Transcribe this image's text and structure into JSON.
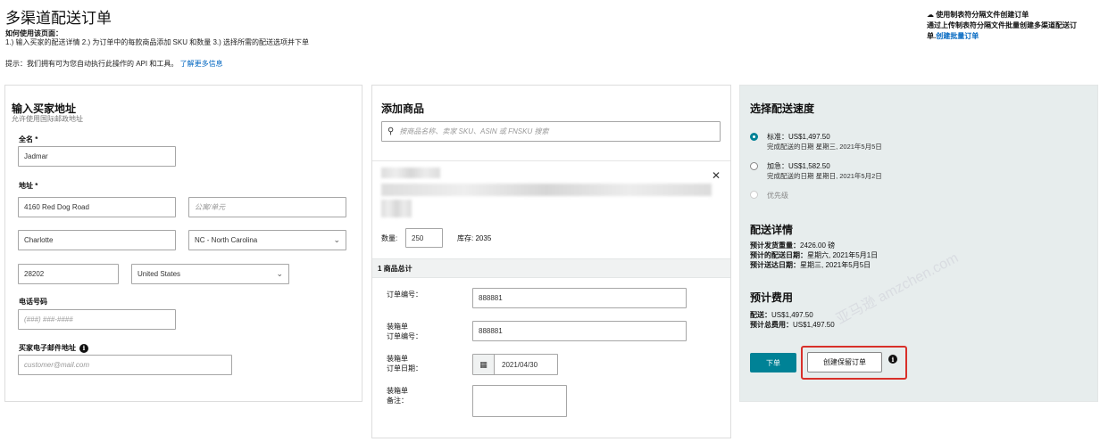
{
  "page": {
    "title": "多渠道配送订单",
    "help_heading": "如何使用该页面：",
    "help_text": "1.) 输入买家的配送详情 2.) 为订单中的每款商品添加 SKU 和数量 3.) 选择所需的配送选项并下单",
    "tip_text": "提示：我们拥有可为您自动执行此操作的 API 和工具。",
    "tip_link": "了解更多信息"
  },
  "bulk": {
    "icon": "cloud-upload-icon",
    "title": "使用制表符分隔文件创建订单",
    "desc": "通过上传制表符分隔文件批量创建多渠道配送订",
    "desc2": "单.",
    "link": "创建批量订单"
  },
  "address": {
    "heading": "输入买家地址",
    "subheading": "允许使用国际邮政地址",
    "name_label": "全名 *",
    "name_value": "Jadmar",
    "address_label": "地址 *",
    "address1_value": "4160  Red Dog Road",
    "address2_placeholder": "公寓/单元",
    "city_value": "Charlotte",
    "state_value": "NC - North Carolina",
    "zip_value": "28202",
    "country_value": "United States",
    "phone_label": "电话号码",
    "phone_placeholder": "(###) ###-####",
    "email_label": "买家电子邮件地址",
    "email_placeholder": "customer@mail.com"
  },
  "products": {
    "heading": "添加商品",
    "search_placeholder": "按商品名称、卖家 SKU、ASIN 或 FNSKU 搜索",
    "qty_label": "数量:",
    "qty_value": "250",
    "stock_label": "库存:",
    "stock_value": "2035",
    "total_label": "1 商品总计",
    "order_id_label": "订单编号：",
    "order_id_value": "888881",
    "packing_id_label": "装箱单\n订单编号：",
    "packing_id_value": "888881",
    "packing_date_label": "装箱单\n订单日期：",
    "packing_date_value": "2021/04/30",
    "packing_note_label": "装箱单\n备注："
  },
  "shipping": {
    "heading": "选择配送速度",
    "options": [
      {
        "title": "标准：US$1,497.50",
        "sub": "完成配送的日期 星期三, 2021年5月5日",
        "state": "selected"
      },
      {
        "title": "加急：US$1,582.50",
        "sub": "完成配送的日期 星期日, 2021年5月2日",
        "state": "normal"
      },
      {
        "title": "优先级",
        "sub": "",
        "state": "disabled"
      }
    ],
    "details_heading": "配送详情",
    "weight_label": "预计发货重量：",
    "weight_value": "2426.00 磅",
    "ship_date_label": "预计的配送日期：",
    "ship_date_value": "星期六, 2021年5月1日",
    "arrive_label": "预计送达日期：",
    "arrive_value": "星期三, 2021年5月5日",
    "cost_heading": "预计费用",
    "ship_cost_label": "配送：",
    "ship_cost_value": "US$1,497.50",
    "total_cost_label": "预计总费用：",
    "total_cost_value": "US$1,497.50",
    "place_order": "下单",
    "hold_order": "创建保留订单"
  },
  "watermark": "亚马逊 amzchen.com",
  "colors": {
    "accent": "#008296",
    "link": "#0066c0",
    "highlight": "#d8302a",
    "panel_gray": "#e7eded"
  }
}
